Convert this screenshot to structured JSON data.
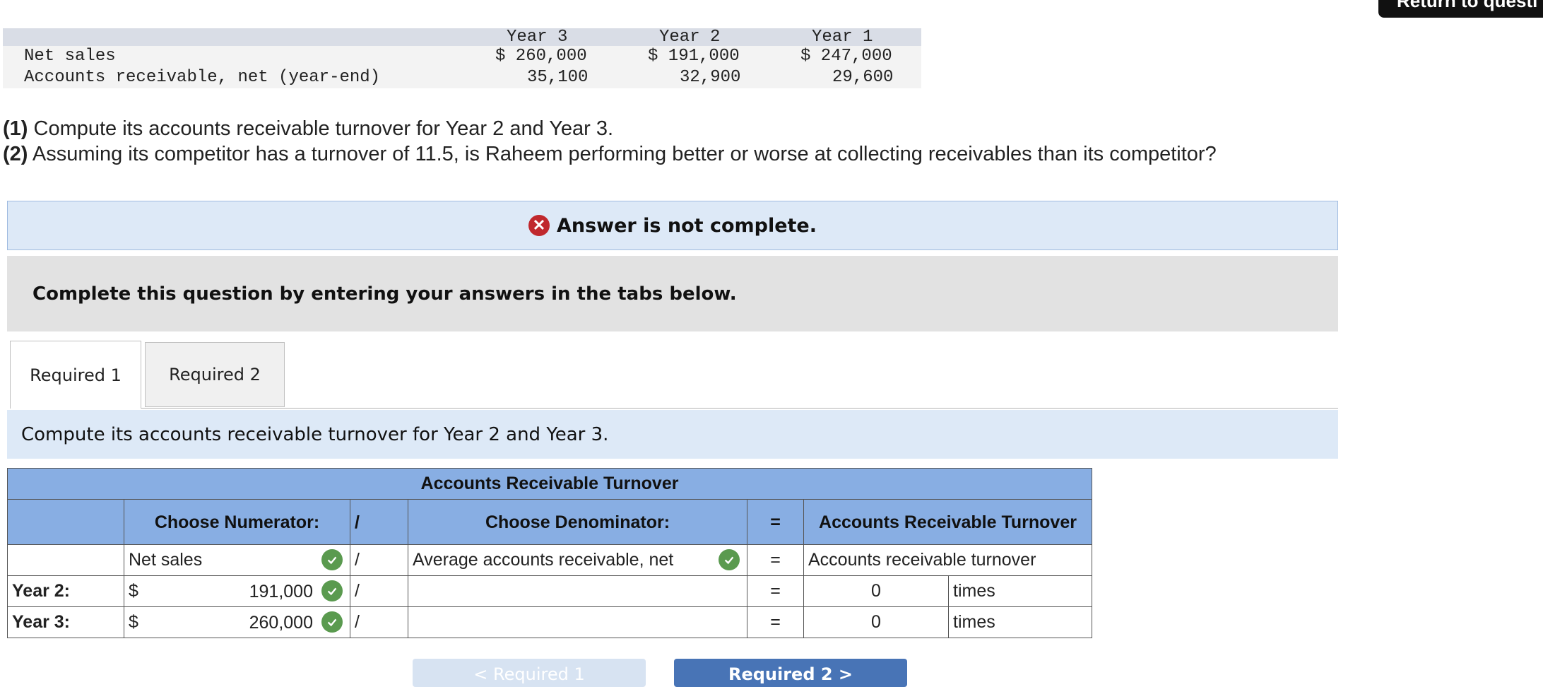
{
  "return_button": {
    "label": "Return to questi"
  },
  "data_table": {
    "headers": [
      "Year 3",
      "Year 2",
      "Year 1"
    ],
    "rows": [
      {
        "label": "Net sales",
        "values": [
          "$ 260,000",
          "$ 191,000",
          "$ 247,000"
        ]
      },
      {
        "label": "Accounts receivable, net (year-end)",
        "values": [
          "35,100",
          "32,900",
          "29,600"
        ]
      }
    ]
  },
  "question": {
    "q1_num": "(1)",
    "q1_text": " Compute its accounts receivable turnover for Year 2 and Year 3.",
    "q2_num": "(2)",
    "q2_text": " Assuming its competitor has a turnover of 11.5, is Raheem performing better or worse at collecting receivables than its competitor?"
  },
  "answer_banner": {
    "text": "Answer is not complete.",
    "icon": "x-icon",
    "color": "#c0282d"
  },
  "instruction": "Complete this question by entering your answers in the tabs below.",
  "tabs": [
    {
      "label": "Required 1",
      "active": true
    },
    {
      "label": "Required 2",
      "active": false
    }
  ],
  "tab_description": "Compute its accounts receivable turnover for Year 2 and Year 3.",
  "ar_table": {
    "title": "Accounts Receivable Turnover",
    "numerator_header": "Choose Numerator:",
    "divide": "/",
    "denominator_header": "Choose Denominator:",
    "equals": "=",
    "result_header": "Accounts Receivable Turnover",
    "formula_row": {
      "numerator": "Net sales",
      "denominator": "Average accounts receivable, net",
      "result": "Accounts receivable turnover"
    },
    "rows": [
      {
        "label": "Year 2:",
        "currency": "$",
        "numerator": "191,000",
        "denominator": "",
        "result": "0",
        "unit": "times"
      },
      {
        "label": "Year 3:",
        "currency": "$",
        "numerator": "260,000",
        "denominator": "",
        "result": "0",
        "unit": "times"
      }
    ],
    "header_color": "#88aee3",
    "check_color": "#5a9a4f"
  },
  "nav": {
    "prev_label": "< Required 1",
    "next_label": "Required 2 >"
  }
}
